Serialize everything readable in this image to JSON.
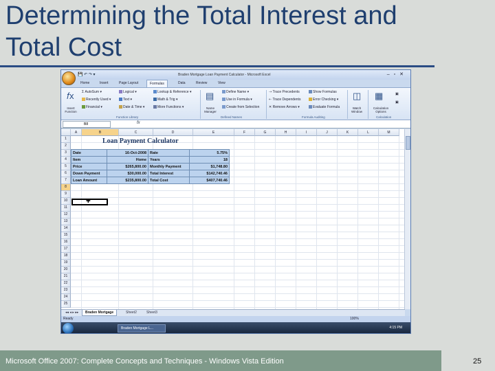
{
  "slide": {
    "title_line1": "Determining the Total Interest and",
    "title_line2": "Total Cost",
    "footer": "Microsoft Office 2007: Complete Concepts and Techniques - Windows Vista Edition",
    "page_number": "25"
  },
  "excel": {
    "window_title": "Braden Mortgage Loan Payment Calculator - Microsoft Excel",
    "tabs": [
      "Home",
      "Insert",
      "Page Layout",
      "Formulas",
      "Data",
      "Review",
      "View"
    ],
    "active_tab": "Formulas",
    "ribbon": {
      "insert_function": "Insert Function",
      "autosum": "AutoSum",
      "recently_used": "Recently Used",
      "financial": "Financial",
      "logical": "Logical",
      "text": "Text",
      "date_time": "Date & Time",
      "lookup_reference": "Lookup & Reference",
      "math_trig": "Math & Trig",
      "more_functions": "More Functions",
      "function_library_label": "Function Library",
      "name_manager": "Name Manager",
      "define_name": "Define Name",
      "use_in_formula": "Use in Formula",
      "create_from_selection": "Create from Selection",
      "defined_names_label": "Defined Names",
      "trace_precedents": "Trace Precedents",
      "trace_dependents": "Trace Dependents",
      "remove_arrows": "Remove Arrows",
      "show_formulas": "Show Formulas",
      "error_checking": "Error Checking",
      "evaluate_formula": "Evaluate Formula",
      "formula_auditing_label": "Formula Auditing",
      "watch_window": "Watch Window",
      "calculation_options": "Calculation Options",
      "calculation_label": "Calculation"
    },
    "name_box": "B8",
    "fx": "fx",
    "columns": [
      "A",
      "B",
      "C",
      "D",
      "E",
      "F",
      "G",
      "H",
      "I",
      "J",
      "K",
      "L",
      "M"
    ],
    "rows": [
      "1",
      "2",
      "3",
      "4",
      "5",
      "6",
      "7",
      "8",
      "9",
      "10",
      "11",
      "12",
      "13",
      "14",
      "15",
      "16",
      "17",
      "18",
      "19",
      "20",
      "21",
      "22",
      "23",
      "24",
      "25"
    ],
    "sheet_heading": "Loan Payment Calculator",
    "table": [
      [
        "Date",
        "16-Oct-2008",
        "Rate",
        "5.75%"
      ],
      [
        "Item",
        "Home",
        "Years",
        "18"
      ],
      [
        "Price",
        "$265,800.00",
        "Monthly Payment",
        "$1,748.80"
      ],
      [
        "Down Payment",
        "$30,000.00",
        "Total Interest",
        "$142,740.46"
      ],
      [
        "Loan Amount",
        "$235,800.00",
        "Total Cost",
        "$407,740.46"
      ]
    ],
    "sheet_tabs": [
      "Braden Mortgage",
      "Sheet2",
      "Sheet3"
    ],
    "status": "Ready",
    "zoom": "100%",
    "taskbar_item": "Braden Mortgage L...",
    "clock": "4:15 PM"
  }
}
